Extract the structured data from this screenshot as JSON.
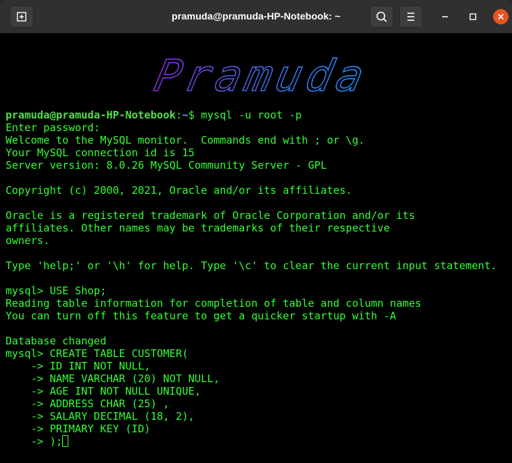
{
  "window": {
    "title": "pramuda@pramuda-HP-Notebook: ~",
    "buttons": {
      "new_tab_icon": "new-tab-icon",
      "search_icon": "search-icon",
      "menu_icon": "hamburger-menu-icon",
      "minimize_icon": "minimize-icon",
      "maximize_icon": "maximize-icon",
      "close_icon": "close-icon"
    },
    "colors": {
      "titlebar": "#303030",
      "terminal_bg": "#000000",
      "text": "#33ff33",
      "close": "#e95420"
    }
  },
  "banner": {
    "text": "Pramuda",
    "colors": [
      "#8a2be2",
      "#4169e1",
      "#1e90ff"
    ]
  },
  "terminal": {
    "prompt_user": "pramuda@pramuda-HP-Notebook",
    "prompt_sep": ":",
    "prompt_path": "~",
    "prompt_cmd": "$ mysql -u root -p",
    "lines": [
      "Enter password:",
      "Welcome to the MySQL monitor.  Commands end with ; or \\g.",
      "Your MySQL connection id is 15",
      "Server version: 8.0.26 MySQL Community Server - GPL",
      "",
      "Copyright (c) 2000, 2021, Oracle and/or its affiliates.",
      "",
      "Oracle is a registered trademark of Oracle Corporation and/or its",
      "affiliates. Other names may be trademarks of their respective",
      "owners.",
      "",
      "Type 'help;' or '\\h' for help. Type '\\c' to clear the current input statement.",
      "",
      "mysql> USE Shop;",
      "Reading table information for completion of table and column names",
      "You can turn off this feature to get a quicker startup with -A",
      "",
      "Database changed",
      "mysql> CREATE TABLE CUSTOMER(",
      "    -> ID INT NOT NULL,",
      "    -> NAME VARCHAR (20) NOT NULL,",
      "    -> AGE INT NOT NULL UNIQUE,",
      "    -> ADDRESS CHAR (25) ,",
      "    -> SALARY DECIMAL (18, 2),",
      "    -> PRIMARY KEY (ID)"
    ],
    "last_line": "    -> );"
  }
}
